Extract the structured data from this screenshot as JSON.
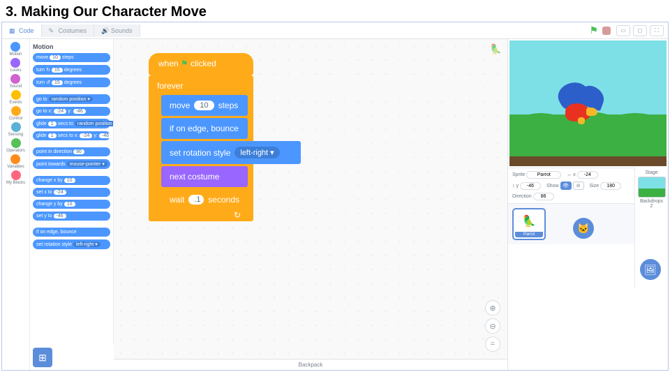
{
  "page_title": "3. Making Our Character Move",
  "tabs": {
    "code": "Code",
    "costumes": "Costumes",
    "sounds": "Sounds"
  },
  "categories": [
    {
      "name": "Motion",
      "color": "#4c97ff"
    },
    {
      "name": "Looks",
      "color": "#9966ff"
    },
    {
      "name": "Sound",
      "color": "#cf63cf"
    },
    {
      "name": "Events",
      "color": "#ffbf00"
    },
    {
      "name": "Control",
      "color": "#ffab19"
    },
    {
      "name": "Sensing",
      "color": "#5cb1d6"
    },
    {
      "name": "Operators",
      "color": "#59c059"
    },
    {
      "name": "Variables",
      "color": "#ff8c1a"
    },
    {
      "name": "My Blocks",
      "color": "#ff6680"
    }
  ],
  "palette": {
    "heading": "Motion",
    "move_label": "move",
    "move_val": "10",
    "steps": "steps",
    "turn_label": "turn",
    "turn_val": "15",
    "degrees": "degrees",
    "goto": "go to",
    "random": "random position ▾",
    "gotoxy": "go to x:",
    "x": "-24",
    "y": "y:",
    "yv": "-46",
    "glide": "glide",
    "one": "1",
    "secs": "secs to",
    "point_dir": "point in direction",
    "dir_val": "90",
    "point_toward": "point towards",
    "mouse": "mouse-pointer ▾",
    "changex": "change x by",
    "ten": "10",
    "setx": "set x to",
    "setxv": "-24",
    "changey": "change y by",
    "sety": "set y to",
    "setyv": "-46",
    "edge": "if on edge, bounce",
    "rot": "set rotation style",
    "lr": "left-right ▾"
  },
  "script": {
    "when_clicked": "when 🏳 clicked",
    "forever": "forever",
    "move": "move",
    "move_val": "10",
    "steps": "steps",
    "edge": "if on edge, bounce",
    "set_rot": "set rotation style",
    "lr": "left-right ▾",
    "next_costume": "next costume",
    "wait": "wait",
    "wait_val": ".1",
    "seconds": "seconds"
  },
  "sprite_info": {
    "sprite_lbl": "Sprite",
    "name": "Parrot",
    "x_lbl": "x",
    "x": "-24",
    "y_lbl": "y",
    "y": "-46",
    "show_lbl": "Show",
    "size_lbl": "Size",
    "size": "180",
    "dir_lbl": "Direction",
    "dir": "86",
    "xy_icon": "↔",
    "y_icon": "↕"
  },
  "stage_panel": {
    "stage": "Stage",
    "backdrops": "Backdrops",
    "count": "2"
  },
  "sprite_card": {
    "name": "Parrot"
  },
  "backpack": "Backpack"
}
